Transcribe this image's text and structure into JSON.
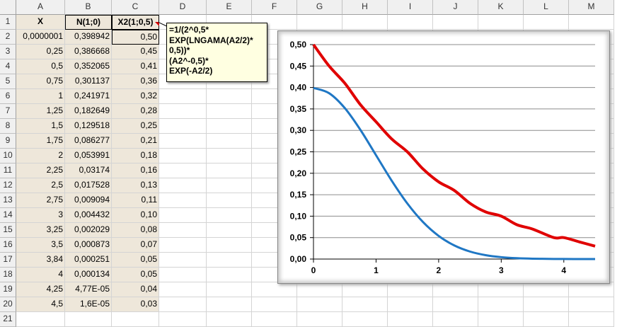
{
  "columns": [
    "A",
    "B",
    "C",
    "D",
    "E",
    "F",
    "G",
    "H",
    "I",
    "J",
    "K",
    "L",
    "M"
  ],
  "rows": [
    "1",
    "2",
    "3",
    "4",
    "5",
    "6",
    "7",
    "8",
    "9",
    "10",
    "11",
    "12",
    "13",
    "14",
    "15",
    "16",
    "17",
    "18",
    "19",
    "20",
    "21"
  ],
  "headers": {
    "a": "X",
    "b": "N(1;0)",
    "c": "X2(1;0,5)"
  },
  "table": [
    [
      "0,0000001",
      "0,398942",
      "0,50"
    ],
    [
      "0,25",
      "0,386668",
      "0,45"
    ],
    [
      "0,5",
      "0,352065",
      "0,41"
    ],
    [
      "0,75",
      "0,301137",
      "0,36"
    ],
    [
      "1",
      "0,241971",
      "0,32"
    ],
    [
      "1,25",
      "0,182649",
      "0,28"
    ],
    [
      "1,5",
      "0,129518",
      "0,25"
    ],
    [
      "1,75",
      "0,086277",
      "0,21"
    ],
    [
      "2",
      "0,053991",
      "0,18"
    ],
    [
      "2,25",
      "0,03174",
      "0,16"
    ],
    [
      "2,5",
      "0,017528",
      "0,13"
    ],
    [
      "2,75",
      "0,009094",
      "0,11"
    ],
    [
      "3",
      "0,004432",
      "0,10"
    ],
    [
      "3,25",
      "0,002029",
      "0,08"
    ],
    [
      "3,5",
      "0,000873",
      "0,07"
    ],
    [
      "3,84",
      "0,000251",
      "0,05"
    ],
    [
      "4",
      "0,000134",
      "0,05"
    ],
    [
      "4,25",
      "4,77E-05",
      "0,04"
    ],
    [
      "4,5",
      "1,6E-05",
      "0,03"
    ]
  ],
  "comment": {
    "lines": [
      "=1/(2^0,5*",
      "EXP(LNGAMA(A2/2)*",
      "0,5))*",
      "(A2^-0,5)*",
      "EXP(-A2/2)"
    ]
  },
  "chart_data": {
    "type": "line",
    "xlim": [
      0,
      4.5
    ],
    "ylim": [
      0,
      0.5
    ],
    "x_ticks": [
      "0",
      "1",
      "2",
      "3",
      "4"
    ],
    "y_ticks": [
      "0,00",
      "0,05",
      "0,10",
      "0,15",
      "0,20",
      "0,25",
      "0,30",
      "0,35",
      "0,40",
      "0,45",
      "0,50"
    ],
    "grid": "horizontal",
    "series": [
      {
        "color": "#e00000",
        "x": [
          0,
          0.25,
          0.5,
          0.75,
          1,
          1.25,
          1.5,
          1.75,
          2,
          2.25,
          2.5,
          2.75,
          3,
          3.25,
          3.5,
          3.84,
          4,
          4.25,
          4.5
        ],
        "y": [
          0.5,
          0.45,
          0.41,
          0.36,
          0.32,
          0.28,
          0.25,
          0.21,
          0.18,
          0.16,
          0.13,
          0.11,
          0.1,
          0.08,
          0.07,
          0.05,
          0.05,
          0.04,
          0.03
        ]
      },
      {
        "color": "#1f77c4",
        "x": [
          0,
          0.25,
          0.5,
          0.75,
          1,
          1.25,
          1.5,
          1.75,
          2,
          2.25,
          2.5,
          2.75,
          3,
          3.25,
          3.5,
          3.84,
          4,
          4.25,
          4.5
        ],
        "y": [
          0.398942,
          0.386668,
          0.352065,
          0.301137,
          0.241971,
          0.182649,
          0.129518,
          0.086277,
          0.053991,
          0.03174,
          0.017528,
          0.009094,
          0.004432,
          0.002029,
          0.000873,
          0.000251,
          0.000134,
          4.77e-05,
          1.6e-05
        ]
      }
    ]
  },
  "colors": {
    "shade": "#eee7da",
    "red": "#e00000",
    "blue": "#1f77c4"
  }
}
